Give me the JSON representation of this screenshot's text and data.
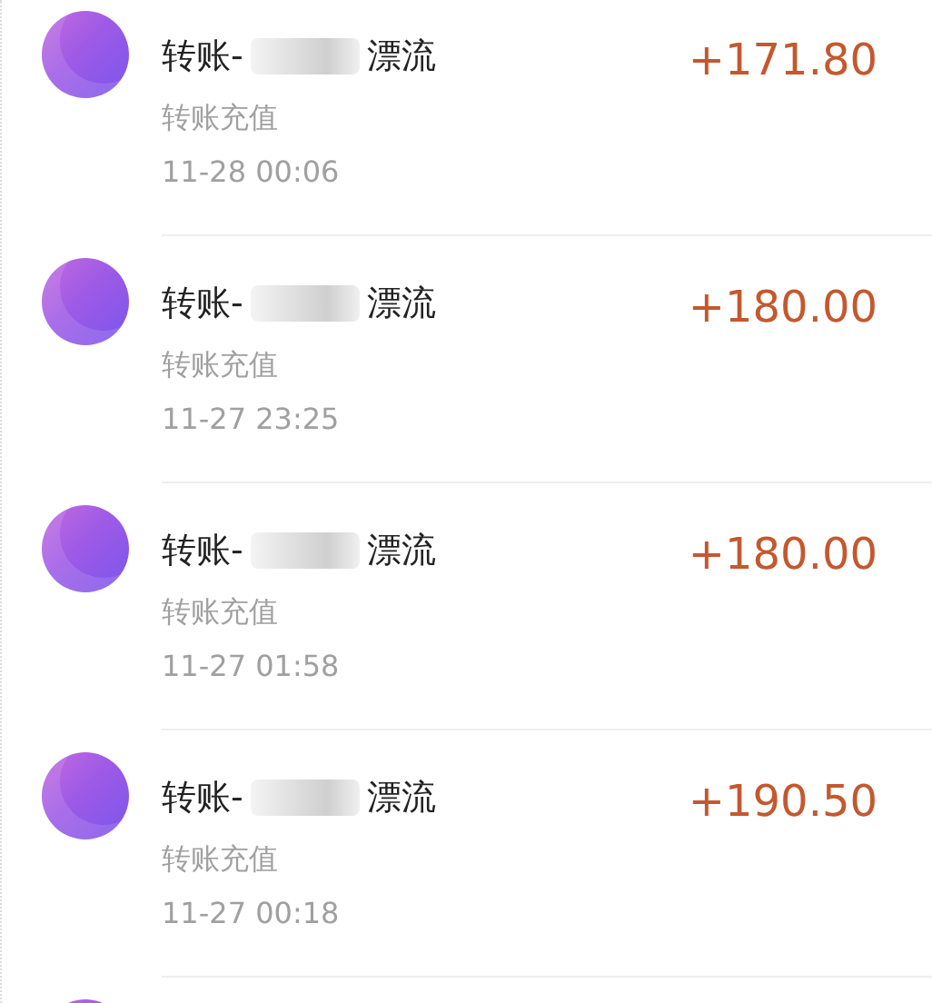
{
  "transactions": [
    {
      "title_start": "转账-",
      "title_end": "漂流",
      "type": "转账充值",
      "time": "11-28  00:06",
      "amount": "+171.80"
    },
    {
      "title_start": "转账-",
      "title_end": "漂流",
      "type": "转账充值",
      "time": "11-27  23:25",
      "amount": "+180.00"
    },
    {
      "title_start": "转账-",
      "title_end": "漂流",
      "type": "转账充值",
      "time": "11-27  01:58",
      "amount": "+180.00"
    },
    {
      "title_start": "转账-",
      "title_end": "漂流",
      "type": "转账充值",
      "time": "11-27  00:18",
      "amount": "+190.50"
    }
  ],
  "more_below": true
}
